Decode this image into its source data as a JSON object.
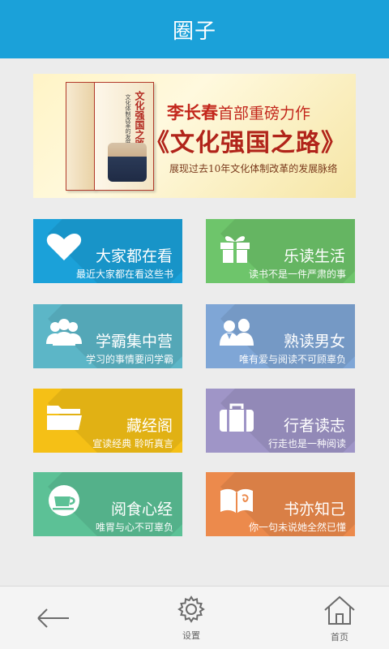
{
  "header": {
    "title": "圈子"
  },
  "banner": {
    "author": "李长春",
    "headline_rest": "首部重磅力作",
    "book_title": "《文化强国之路》",
    "tagline": "展现过去10年文化体制改革的发展脉络",
    "spine_title": "文化强国之路",
    "spine_sub": "文化体制改革的发展脉络"
  },
  "tiles": [
    {
      "title": "大家都在看",
      "subtitle": "最近大家都在看这些书",
      "icon": "heart-icon",
      "color": "#1ba1d9"
    },
    {
      "title": "乐读生活",
      "subtitle": "读书不是一件严肃的事",
      "icon": "gift-icon",
      "color": "#6ec56b"
    },
    {
      "title": "学霸集中营",
      "subtitle": "学习的事情要问学霸",
      "icon": "users-icon",
      "color": "#5cb6c7"
    },
    {
      "title": "熟读男女",
      "subtitle": "唯有爱与阅读不可顾辜负",
      "icon": "couple-icon",
      "color": "#7fa6d6"
    },
    {
      "title": "藏经阁",
      "subtitle": "宣读经典  聆听真言",
      "icon": "folder-icon",
      "color": "#f5c016"
    },
    {
      "title": "行者读志",
      "subtitle": "行走也是一种阅读",
      "icon": "suitcase-icon",
      "color": "#9f95c7"
    },
    {
      "title": "阅食心经",
      "subtitle": "唯胃与心不可辜负",
      "icon": "coffee-cup-icon",
      "color": "#5cc196"
    },
    {
      "title": "书亦知己",
      "subtitle": "你一句未说她全然已懂",
      "icon": "open-book-icon",
      "color": "#ec8a4c"
    }
  ],
  "footer": {
    "settings_label": "设置",
    "home_label": "首页"
  }
}
